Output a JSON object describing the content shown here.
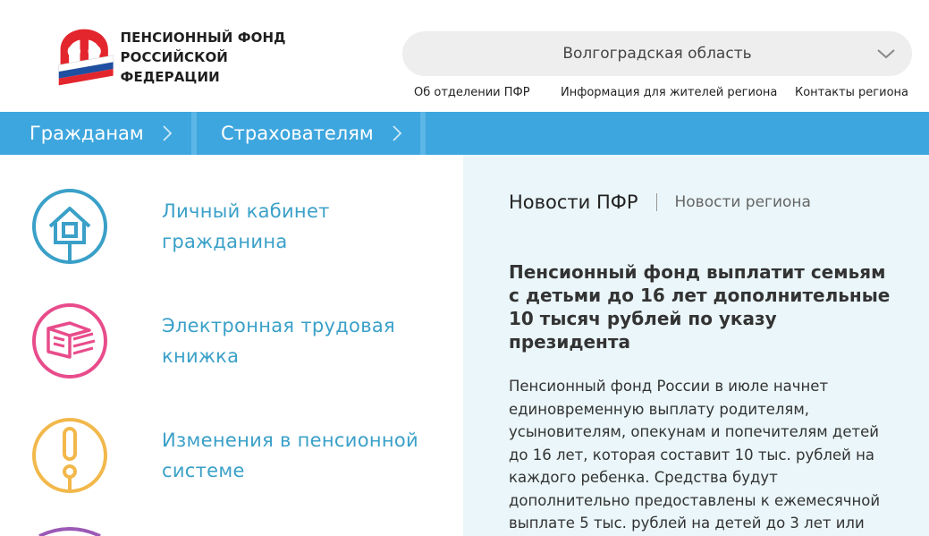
{
  "header": {
    "logo_line1": "ПЕНСИОННЫЙ ФОНД",
    "logo_line2": "РОССИЙСКОЙ ФЕДЕРАЦИИ",
    "region": "Волгоградская область",
    "links": [
      "Об отделении  ПФР",
      "Информация для жителей региона",
      "Контакты региона"
    ]
  },
  "nav": {
    "items": [
      "Гражданам",
      "Страхователям"
    ]
  },
  "services": [
    {
      "label_line1": "Личный кабинет",
      "label_line2": "гражданина",
      "icon": "house-icon",
      "color": "#3aa0c8"
    },
    {
      "label_line1": "Электронная трудовая",
      "label_line2": "книжка",
      "icon": "book-icon",
      "color": "#e84c8b"
    },
    {
      "label_line1": "Изменения в пенсионной",
      "label_line2": "системе",
      "icon": "exclamation-icon",
      "color": "#f2b84b"
    }
  ],
  "news": {
    "tab_active": "Новости ПФР",
    "tab_inactive": "Новости региона",
    "title": "Пенсионный фонд выплатит семьям с детьми до 16 лет дополнительные 10 тысяч рублей по указу президента",
    "body": "Пенсионный фонд России в июле начнет единовременную выплату родителям, усыновителям, опекунам и попечителям детей до 16 лет, которая составит 10 тыс. рублей на каждого ребенка. Средства будут дополнительно предоставлены к ежемесячной выплате 5 тыс. рублей на детей до 3 лет или"
  },
  "colors": {
    "nav_bg": "#3ea6de",
    "accent_text": "#3aa0c8",
    "news_bg": "#eaf6f9",
    "logo_red": "#e3262d",
    "logo_blue": "#1e4fa0"
  }
}
